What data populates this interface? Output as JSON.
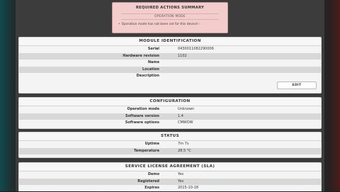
{
  "alert": {
    "title": "REQUIRED ACTIONS SUMMARY",
    "subtitle": "OPERATION MODE",
    "message": "Operation mode has not been set for this device!",
    "arrow": "›"
  },
  "module": {
    "title": "MODULE IDENTIFICATION",
    "rows": [
      {
        "label": "Serial",
        "value": "0430011082290006"
      },
      {
        "label": "Hardware revision",
        "value": "1102"
      },
      {
        "label": "Name",
        "value": ""
      },
      {
        "label": "Location",
        "value": ""
      },
      {
        "label": "Description",
        "value": ""
      }
    ],
    "edit_label": "EDIT"
  },
  "configuration": {
    "title": "CONFIGURATION",
    "rows": [
      {
        "label": "Operation mode",
        "value": "Unknown"
      },
      {
        "label": "Software version",
        "value": "1.4"
      },
      {
        "label": "Software options",
        "value": "CMWOW"
      }
    ]
  },
  "status": {
    "title": "STATUS",
    "rows": [
      {
        "label": "Uptime",
        "value": "7m 7s"
      },
      {
        "label": "Temperature",
        "value": "28.5 °C"
      }
    ]
  },
  "sla": {
    "title": "SERVICE LICENSE AGREEMENT (SLA)",
    "rows": [
      {
        "label": "Demo",
        "value": "Yes"
      },
      {
        "label": "Registered",
        "value": "Yes"
      },
      {
        "label": "Expires",
        "value": "2015-10-18"
      }
    ]
  }
}
